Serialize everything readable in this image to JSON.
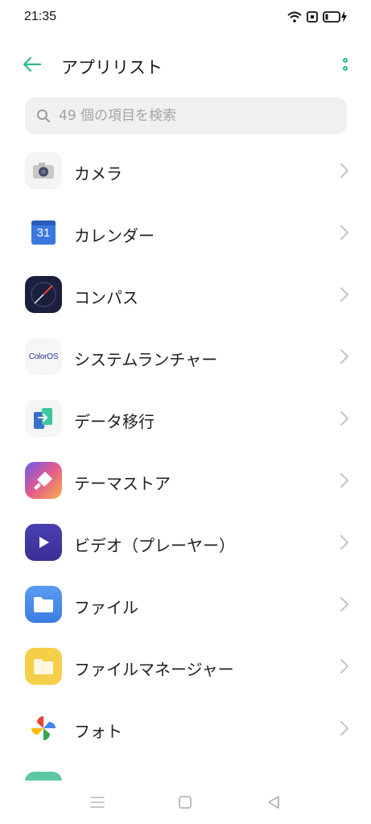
{
  "status_bar": {
    "time": "21:35",
    "icons": [
      "wifi-icon",
      "sim-icon",
      "battery-charging-icon"
    ]
  },
  "header": {
    "title": "アプリリスト",
    "back_icon": "arrow-left-icon",
    "more_icon": "more-vertical-icon",
    "accent": "#2fb88a"
  },
  "search": {
    "placeholder": "49 個の項目を検索",
    "icon": "search-icon"
  },
  "apps": [
    {
      "label": "カメラ",
      "icon": "camera-icon"
    },
    {
      "label": "カレンダー",
      "icon": "calendar-icon",
      "icon_text": "31"
    },
    {
      "label": "コンパス",
      "icon": "compass-icon"
    },
    {
      "label": "システムランチャー",
      "icon": "coloros-icon",
      "icon_text": "ColorOS"
    },
    {
      "label": "データ移行",
      "icon": "data-transfer-icon"
    },
    {
      "label": "テーマストア",
      "icon": "theme-store-icon"
    },
    {
      "label": "ビデオ（プレーヤー）",
      "icon": "video-player-icon"
    },
    {
      "label": "ファイル",
      "icon": "folder-icon"
    },
    {
      "label": "ファイルマネージャー",
      "icon": "file-manager-icon"
    },
    {
      "label": "フォト",
      "icon": "photos-pinwheel-icon"
    },
    {
      "label": "",
      "icon": "partial-app-icon"
    }
  ],
  "nav": [
    "menu-icon",
    "home-square-icon",
    "back-triangle-icon"
  ]
}
